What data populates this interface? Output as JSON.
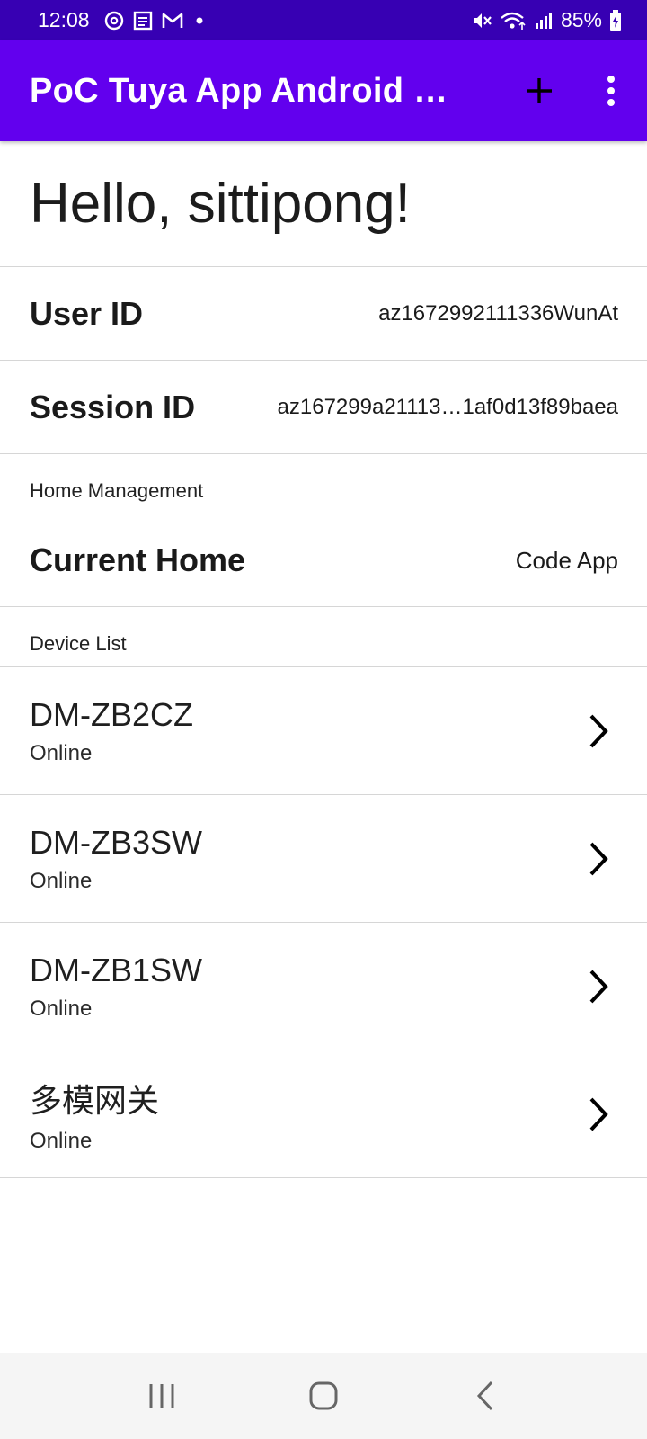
{
  "status_bar": {
    "time": "12:08",
    "battery": "85%",
    "icons_left": [
      "sync-icon",
      "news-icon",
      "gmail-icon",
      "dot-icon"
    ],
    "icons_right": [
      "mute-icon",
      "wifi-icon",
      "signal-icon",
      "battery-icon"
    ]
  },
  "app_bar": {
    "title": "PoC Tuya App Android S…",
    "background": "#6200ee",
    "add_icon": "plus-icon",
    "menu_icon": "more-vert-icon"
  },
  "greeting": "Hello, sittipong!",
  "user": {
    "user_id_label": "User ID",
    "user_id_value": "az1672992111336WunAt",
    "session_id_label": "Session ID",
    "session_id_value": "az167299a21113…1af0d13f89baea"
  },
  "home_management": {
    "header": "Home Management",
    "current_home_label": "Current Home",
    "current_home_value": "Code App"
  },
  "device_list": {
    "header": "Device List",
    "devices": [
      {
        "name": "DM-ZB2CZ",
        "status": "Online"
      },
      {
        "name": "DM-ZB3SW",
        "status": "Online"
      },
      {
        "name": "DM-ZB1SW",
        "status": "Online"
      },
      {
        "name": "多模网关",
        "status": "Online"
      }
    ]
  },
  "nav_bar": {
    "recents_icon": "recents-icon",
    "home_icon": "home-icon",
    "back_icon": "back-icon"
  }
}
